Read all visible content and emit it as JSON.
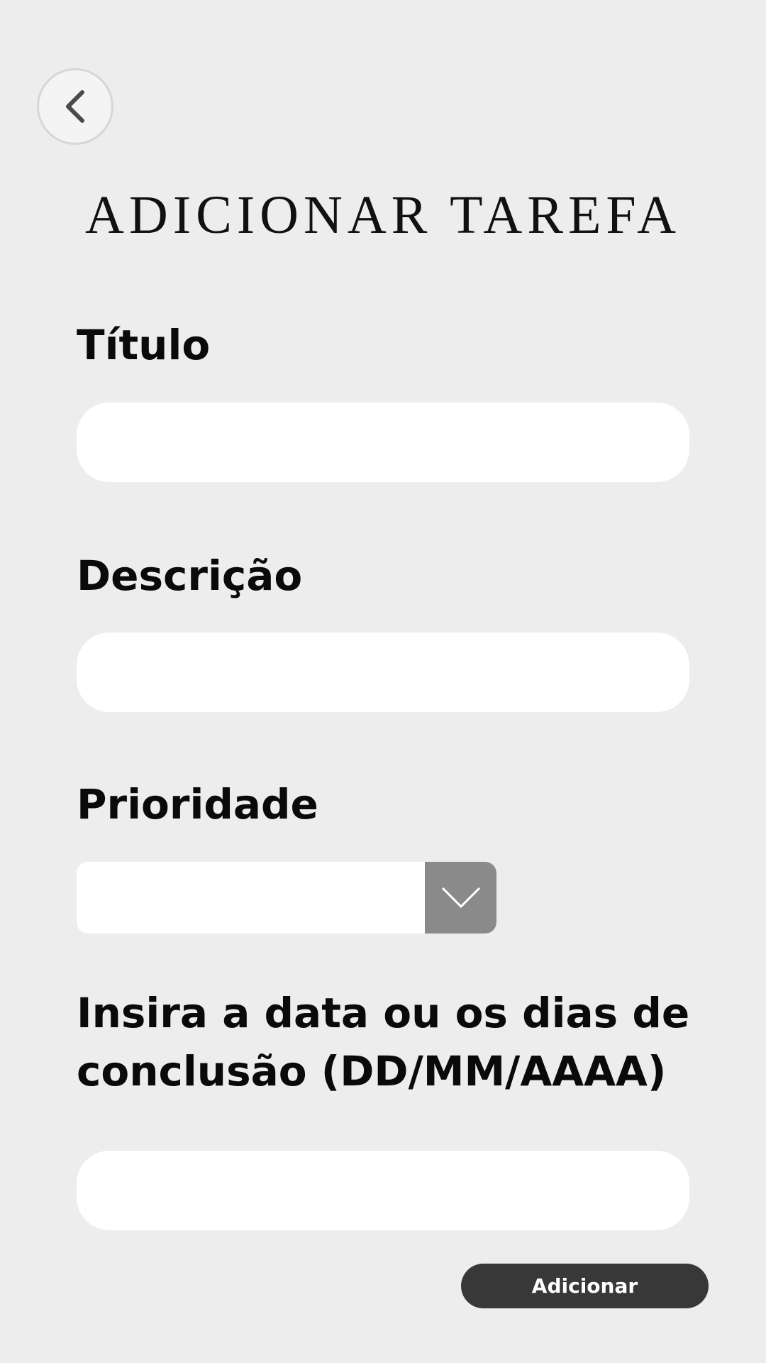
{
  "header": {
    "back_icon": "chevron-left-icon",
    "title": "ADICIONAR TAREFA"
  },
  "form": {
    "title_label": "Título",
    "title_value": "",
    "description_label": "Descrição",
    "description_value": "",
    "priority_label": "Prioridade",
    "priority_value": "",
    "priority_icon": "chevron-down-icon",
    "date_label_line1": "Insira a data ou os dias de",
    "date_label_line2": "conclusão (DD/MM/AAAA)",
    "date_value": "",
    "submit_label": "Adicionar"
  },
  "colors": {
    "background": "#ededed",
    "input_background": "#ffffff",
    "select_arrow_background": "#8a8a8a",
    "button_background": "#383838",
    "button_text": "#ffffff"
  }
}
